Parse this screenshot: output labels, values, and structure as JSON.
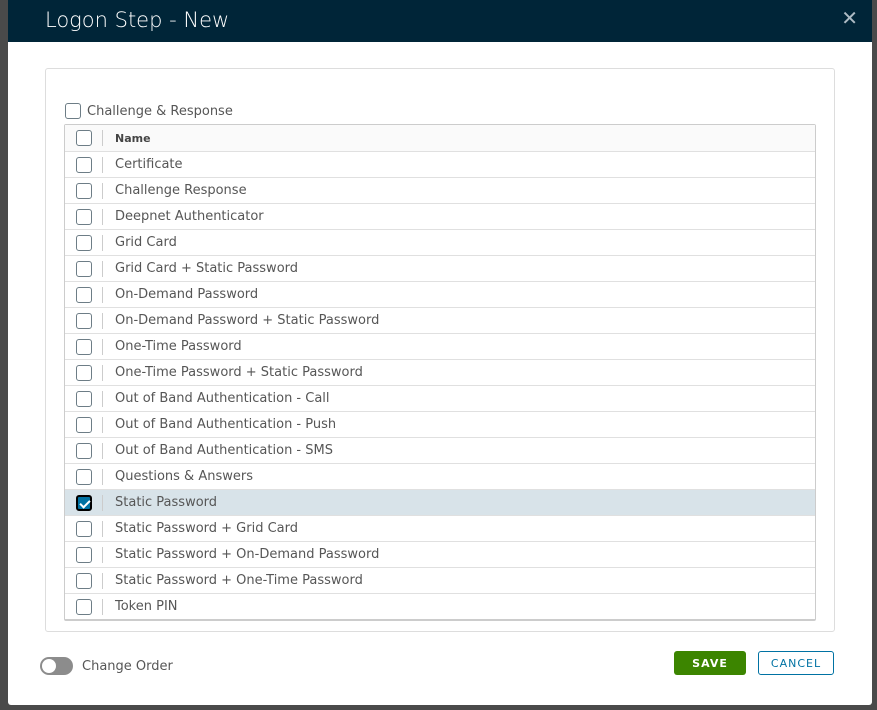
{
  "dialog": {
    "title": "Logon Step - New",
    "close_icon": "close-icon"
  },
  "challenge_label": "Challenge & Response",
  "table": {
    "header": "Name",
    "rows": [
      {
        "label": "Certificate",
        "checked": false
      },
      {
        "label": "Challenge Response",
        "checked": false
      },
      {
        "label": "Deepnet Authenticator",
        "checked": false
      },
      {
        "label": "Grid Card",
        "checked": false
      },
      {
        "label": "Grid Card + Static Password",
        "checked": false
      },
      {
        "label": "On-Demand Password",
        "checked": false
      },
      {
        "label": "On-Demand Password + Static Password",
        "checked": false
      },
      {
        "label": "One-Time Password",
        "checked": false
      },
      {
        "label": "One-Time Password + Static Password",
        "checked": false
      },
      {
        "label": "Out of Band Authentication - Call",
        "checked": false
      },
      {
        "label": "Out of Band Authentication - Push",
        "checked": false
      },
      {
        "label": "Out of Band Authentication - SMS",
        "checked": false
      },
      {
        "label": "Questions & Answers",
        "checked": false
      },
      {
        "label": "Static Password",
        "checked": true
      },
      {
        "label": "Static Password + Grid Card",
        "checked": false
      },
      {
        "label": "Static Password + On-Demand Password",
        "checked": false
      },
      {
        "label": "Static Password + One-Time Password",
        "checked": false
      },
      {
        "label": "Token PIN",
        "checked": false
      }
    ]
  },
  "footer": {
    "toggle_label": "Change Order",
    "toggle_on": false,
    "save": "SAVE",
    "cancel": "CANCEL"
  }
}
